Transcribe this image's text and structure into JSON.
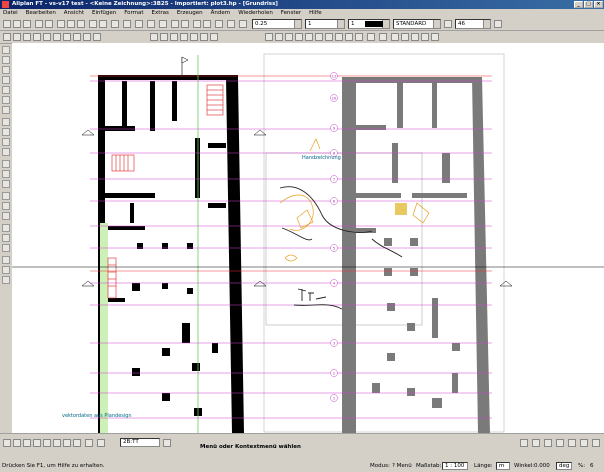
{
  "window": {
    "title": "Allplan FT - vs-v17 test - <Keine Zeichnung>:3B25 - Importiert: plot3.hp - [Grundriss]"
  },
  "menu": [
    "Datei",
    "Bearbeiten",
    "Ansicht",
    "Einfügen",
    "Format",
    "Extras",
    "Erzeugen",
    "Ändern",
    "Wiederholen",
    "Fenster",
    "Hilfe"
  ],
  "toolbar": {
    "pen_thickness": "0.25",
    "line_type": "1",
    "color_index": "1",
    "layer": "STANDARD",
    "scale_value": "46"
  },
  "drawing": {
    "label_handzeichnung": "Handzeichnung",
    "label_vektordaten": "vektordaten aus Plandesign",
    "axis_numbers": [
      "11",
      "10",
      "9",
      "8",
      "7",
      "6",
      "5",
      "4",
      "3",
      "2",
      "1"
    ]
  },
  "bottom_toolbar": {
    "zoom_value": "2B:TT",
    "prompt": "Menü oder Kontextmenü wählen"
  },
  "status": {
    "hint": "Drücken Sie F1, um Hilfe zu erhalten.",
    "modus_label": "Modus:",
    "modus_value": "? Menü",
    "massstab_label": "Maßstab:",
    "massstab_value": "1 : 100",
    "laenge_label": "Länge:",
    "laenge_value": "m",
    "winkel_label": "Winkel:",
    "winkel_value": "0.000",
    "einheit_value": "deg",
    "prozent_label": "%:",
    "prozent_value": "6"
  }
}
